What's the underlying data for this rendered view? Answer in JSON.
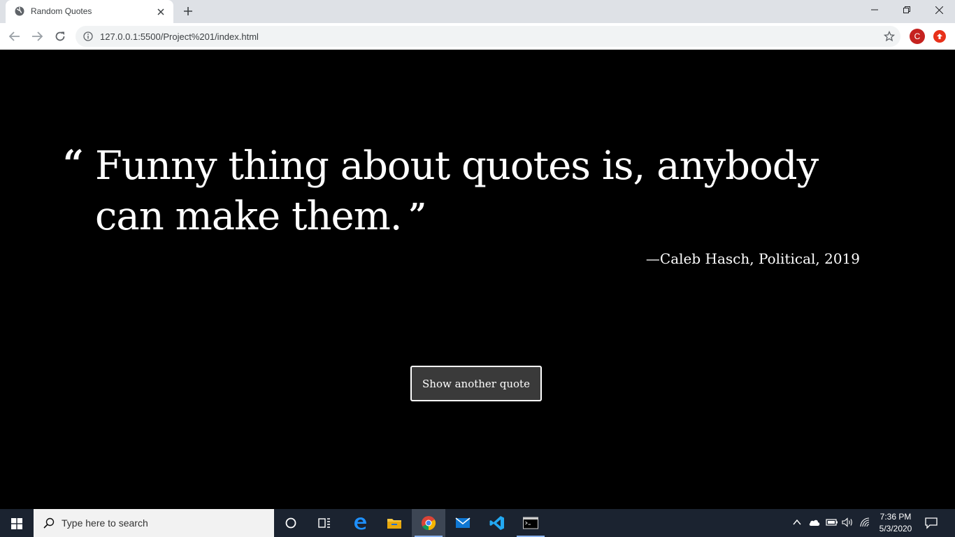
{
  "browser": {
    "tab_title": "Random Quotes",
    "url": "127.0.0.1:5500/Project%201/index.html",
    "profile_initial": "C"
  },
  "quote": {
    "open_mark": "“",
    "text": "Funny thing about quotes is, anybody can make them.",
    "close_mark": "”",
    "attribution": "—Caleb Hasch, Political, 2019"
  },
  "button": {
    "label": "Show another quote"
  },
  "taskbar": {
    "search_placeholder": "Type here to search",
    "time": "7:36 PM",
    "date": "5/3/2020"
  },
  "colors": {
    "page_background": "#000000",
    "text": "#ffffff",
    "button_background": "#3a3a3a",
    "taskbar": "#1b2330"
  }
}
